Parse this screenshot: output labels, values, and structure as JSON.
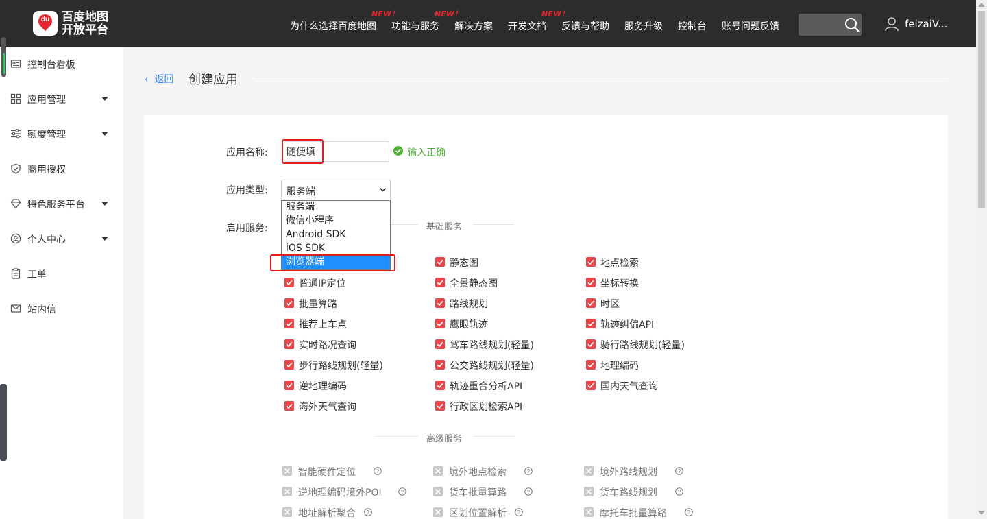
{
  "header": {
    "logo_line1": "百度地图",
    "logo_line2": "开放平台",
    "logo_badge": "du",
    "nav": [
      {
        "label": "为什么选择百度地图",
        "new": ""
      },
      {
        "label": "功能与服务",
        "new": "NEW！"
      },
      {
        "label": "解决方案",
        "new": "NEW！"
      },
      {
        "label": "开发文档",
        "new": "NEW！"
      },
      {
        "label": "反馈与帮助",
        "new": ""
      },
      {
        "label": "服务升级",
        "new": ""
      },
      {
        "label": "控制台",
        "new": ""
      },
      {
        "label": "账号问题反馈",
        "new": ""
      }
    ],
    "search_placeholder": "",
    "username": "feizaiV..."
  },
  "sidebar": {
    "items": [
      {
        "label": "控制台看板",
        "icon": "dashboard-icon",
        "has_caret": false
      },
      {
        "label": "应用管理",
        "icon": "grid-icon",
        "has_caret": true
      },
      {
        "label": "额度管理",
        "icon": "sliders-icon",
        "has_caret": true
      },
      {
        "label": "商用授权",
        "icon": "shield-icon",
        "has_caret": false
      },
      {
        "label": "特色服务平台",
        "icon": "diamond-icon",
        "has_caret": true
      },
      {
        "label": "个人中心",
        "icon": "user-circle-icon",
        "has_caret": true
      },
      {
        "label": "工单",
        "icon": "clipboard-icon",
        "has_caret": false
      },
      {
        "label": "站内信",
        "icon": "mail-icon",
        "has_caret": false
      }
    ]
  },
  "page": {
    "back_label": "返回",
    "title": "创建应用"
  },
  "form": {
    "app_name_label": "应用名称:",
    "app_name_value": "随便填",
    "app_name_status": "输入正确",
    "app_type_label": "应用类型:",
    "app_type_value": "服务端",
    "app_type_options": [
      "服务端",
      "微信小程序",
      "Android SDK",
      "iOS SDK",
      "浏览器端"
    ],
    "app_type_highlighted": "浏览器端",
    "services_label": "启用服务:"
  },
  "basic_services": {
    "title": "基础服务",
    "items": [
      {
        "label": "静态图",
        "checked": true
      },
      {
        "label": "地点检索",
        "checked": true
      },
      {
        "label": "普通IP定位",
        "checked": true
      },
      {
        "label": "全景静态图",
        "checked": true
      },
      {
        "label": "坐标转换",
        "checked": true
      },
      {
        "label": "批量算路",
        "checked": true
      },
      {
        "label": "路线规划",
        "checked": true
      },
      {
        "label": "时区",
        "checked": true
      },
      {
        "label": "推荐上车点",
        "checked": true
      },
      {
        "label": "鹰眼轨迹",
        "checked": true
      },
      {
        "label": "轨迹纠偏API",
        "checked": true
      },
      {
        "label": "实时路况查询",
        "checked": true
      },
      {
        "label": "驾车路线规划(轻量)",
        "checked": true
      },
      {
        "label": "骑行路线规划(轻量)",
        "checked": true
      },
      {
        "label": "步行路线规划(轻量)",
        "checked": true
      },
      {
        "label": "公交路线规划(轻量)",
        "checked": true
      },
      {
        "label": "地理编码",
        "checked": true
      },
      {
        "label": "逆地理编码",
        "checked": true
      },
      {
        "label": "轨迹重合分析API",
        "checked": true
      },
      {
        "label": "国内天气查询",
        "checked": true
      },
      {
        "label": "海外天气查询",
        "checked": true
      },
      {
        "label": "行政区划检索API",
        "checked": true
      }
    ]
  },
  "advanced_services": {
    "title": "高级服务",
    "items": [
      {
        "label": "智能硬件定位"
      },
      {
        "label": "境外地点检索"
      },
      {
        "label": "境外路线规划"
      },
      {
        "label": "逆地理编码境外POI"
      },
      {
        "label": "货车批量算路"
      },
      {
        "label": "货车路线规划"
      },
      {
        "label": "地址解析聚合"
      },
      {
        "label": "区划位置解析"
      },
      {
        "label": "摩托车批量算路"
      }
    ]
  },
  "colors": {
    "header_bg": "#2c2c2c",
    "accent_red": "#e6262e",
    "checkbox_red": "#e6454a",
    "success_green": "#52b03a",
    "link_blue": "#3385ff",
    "dropdown_highlight": "#1e90ff"
  }
}
